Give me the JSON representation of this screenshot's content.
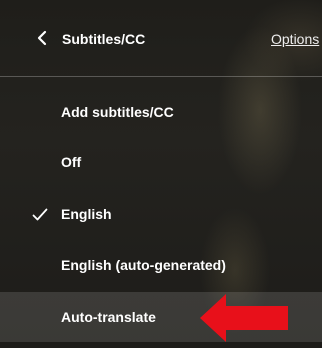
{
  "header": {
    "title": "Subtitles/CC",
    "options_label": "Options"
  },
  "items": [
    {
      "label": "Add subtitles/CC",
      "selected": false
    },
    {
      "label": "Off",
      "selected": false
    },
    {
      "label": "English",
      "selected": true
    },
    {
      "label": "English (auto-generated)",
      "selected": false
    },
    {
      "label": "Auto-translate",
      "selected": false,
      "highlighted": true
    }
  ],
  "colors": {
    "text": "#ffffff",
    "annotation_arrow": "#e8101a"
  },
  "icons": {
    "back": "chevron-left-icon",
    "selected": "check-icon",
    "annotation": "red-arrow-icon"
  }
}
